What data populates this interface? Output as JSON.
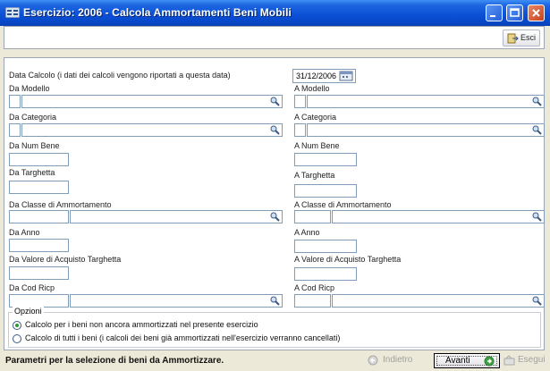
{
  "window": {
    "title": "Esercizio: 2006 - Calcola Ammortamenti Beni Mobili"
  },
  "toolbar": {
    "exit_label": "Esci"
  },
  "form": {
    "data_calcolo_label": "Data Calcolo (i dati dei calcoli vengono riportati a questa data)",
    "data_calcolo_value": "31/12/2006",
    "da_modello": "Da Modello",
    "a_modello": "A Modello",
    "da_categoria": "Da Categoria",
    "a_categoria": "A Categoria",
    "da_num_bene": "Da Num Bene",
    "a_num_bene": "A Num Bene",
    "da_targhetta": "Da Targhetta",
    "a_targhetta": "A Targhetta",
    "da_classe": "Da Classe di Ammortamento",
    "a_classe": "A Classe di Ammortamento",
    "da_anno": "Da Anno",
    "a_anno": "A Anno",
    "da_valore": "Da Valore di Acquisto Targhetta",
    "a_valore": "A Valore di Acquisto Targhetta",
    "da_cod_ricp": "Da Cod Ricp",
    "a_cod_ricp": "A Cod Ricp"
  },
  "options": {
    "legend": "Opzioni",
    "option1": "Calcolo per i beni non ancora ammortizzati nel presente esercizio",
    "option2": "Calcolo di tutti i beni (i calcoli dei beni già ammortizzati nell'esercizio verranno cancellati)",
    "selected": 1
  },
  "status": {
    "message": "Parametri per la selezione di beni da Ammortizzare.",
    "back_label": "Indietro",
    "next_label": "Avanti",
    "run_label": "Esegui"
  },
  "colors": {
    "titlebar": "#0a4fd6",
    "frame": "#ece9d8",
    "field_border": "#7f9db9",
    "radio_dot": "#2d9a36"
  }
}
